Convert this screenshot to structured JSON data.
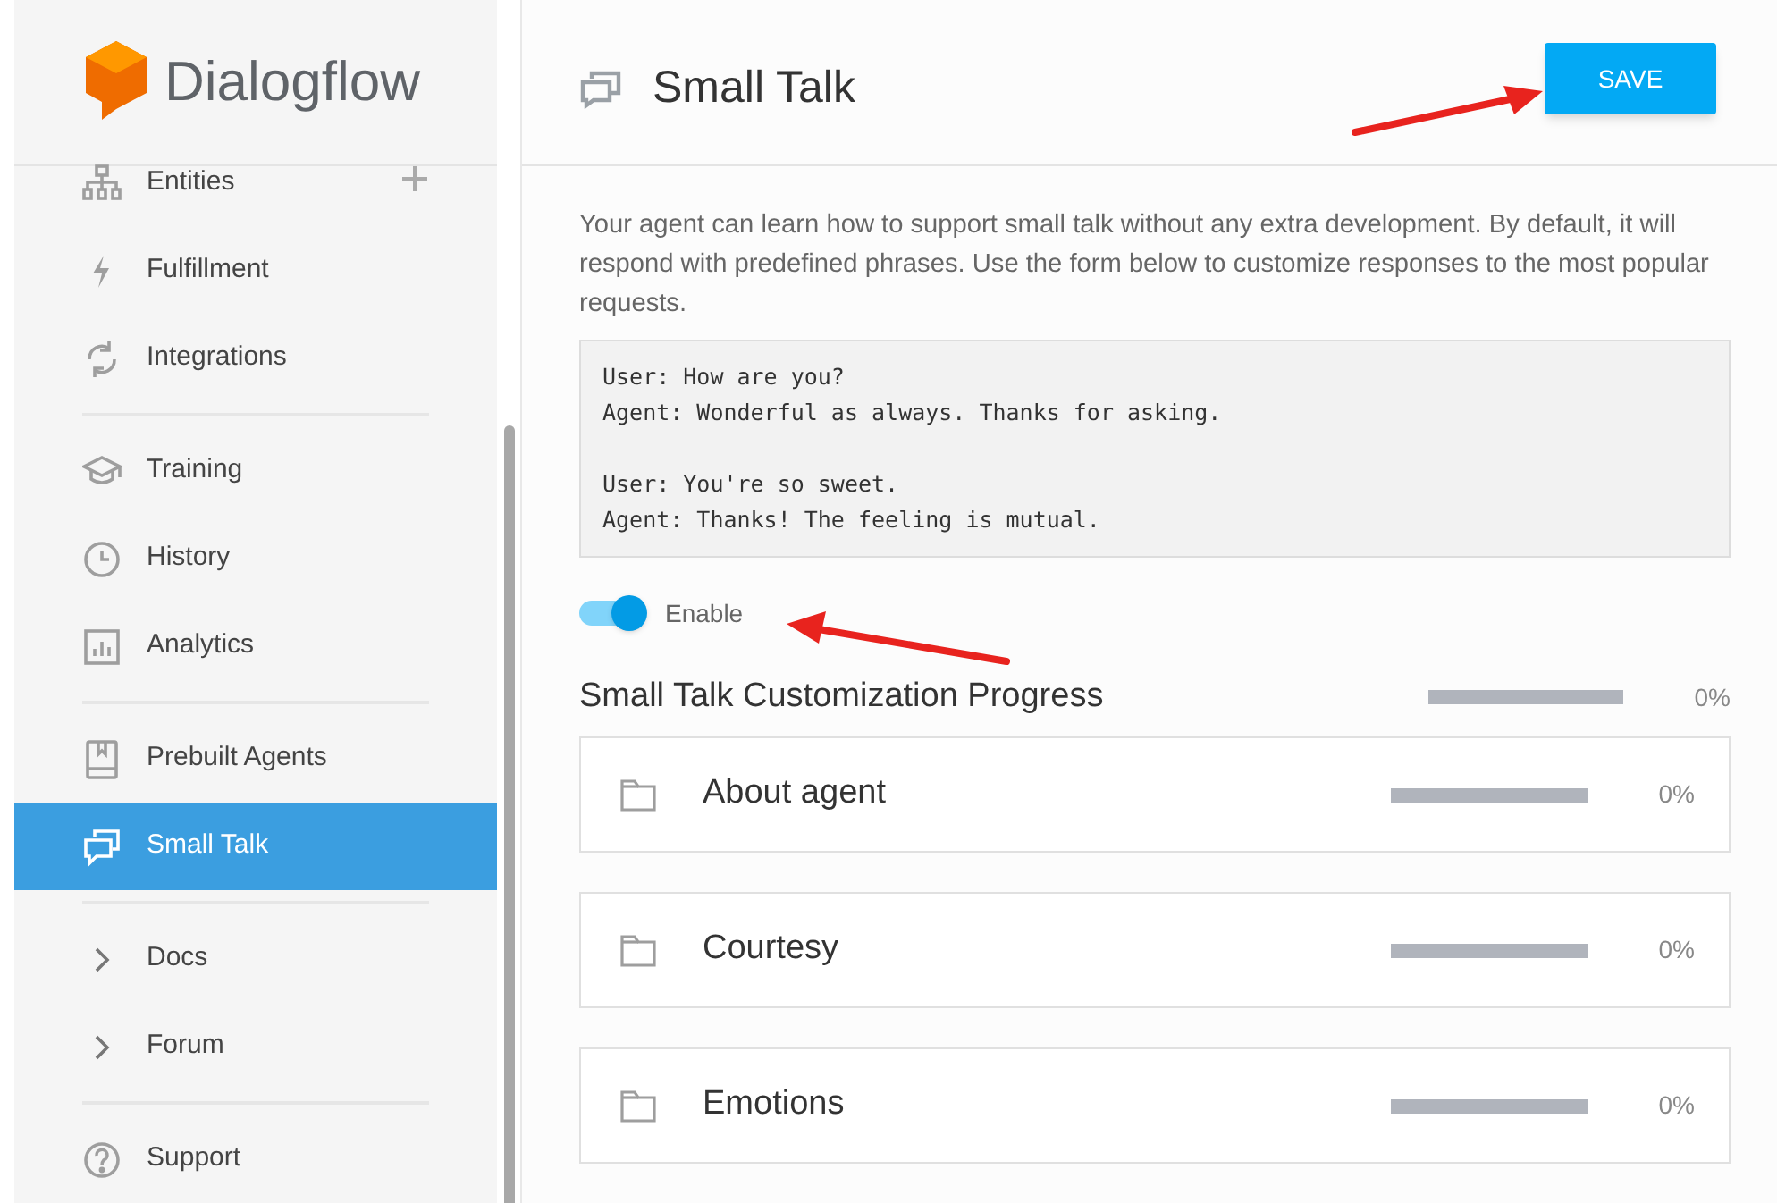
{
  "logo": {
    "name": "Dialogflow"
  },
  "sidebar": {
    "sections": [
      [
        {
          "label": "Entities",
          "kind": "page",
          "selected": false,
          "add": true
        },
        {
          "label": "Fulfillment",
          "kind": "page",
          "selected": false
        },
        {
          "label": "Integrations",
          "kind": "page",
          "selected": false
        }
      ],
      [
        {
          "label": "Training",
          "kind": "page",
          "selected": false
        },
        {
          "label": "History",
          "kind": "page",
          "selected": false
        },
        {
          "label": "Analytics",
          "kind": "page",
          "selected": false
        }
      ],
      [
        {
          "label": "Prebuilt Agents",
          "kind": "page",
          "selected": false
        },
        {
          "label": "Small Talk",
          "kind": "page",
          "selected": true
        }
      ],
      [
        {
          "label": "Docs",
          "kind": "link",
          "selected": false
        },
        {
          "label": "Forum",
          "kind": "link",
          "selected": false
        }
      ],
      [
        {
          "label": "Support",
          "kind": "page",
          "selected": false
        }
      ]
    ]
  },
  "header": {
    "title": "Small Talk",
    "save_button": "SAVE"
  },
  "intro": "Your agent can learn how to support small talk without any extra development. By default, it will respond with predefined phrases. Use the form below to customize responses to the most popular requests.",
  "example": [
    {
      "user": "User: How are you?",
      "agent": "Agent: Wonderful as always. Thanks for asking."
    },
    {
      "user": "User: You're so sweet.",
      "agent": "Agent: Thanks! The feeling is mutual."
    }
  ],
  "enable": {
    "label": "Enable",
    "on": true
  },
  "progress": {
    "title": "Small Talk Customization Progress",
    "level": 0,
    "reading": "0%"
  },
  "categories": [
    {
      "name": "About agent",
      "level": 0,
      "reading": "0%"
    },
    {
      "name": "Courtesy",
      "level": 0,
      "reading": "0%"
    },
    {
      "name": "Emotions",
      "level": 0,
      "reading": "0%"
    }
  ]
}
